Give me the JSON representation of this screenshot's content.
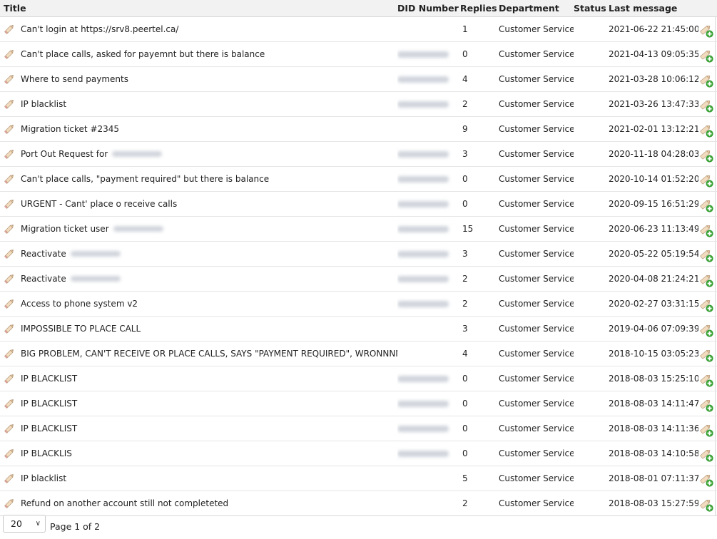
{
  "columns": {
    "title": "Title",
    "did": "DID Number",
    "replies": "Replies",
    "department": "Department",
    "status": "Status",
    "last_message": "Last message"
  },
  "icons": {
    "row_edit": "pencil-icon",
    "row_action": "add-note-icon",
    "accent": "#3aa635"
  },
  "tickets": [
    {
      "title": "Can't login at https://srv8.peertel.ca/",
      "did_blurred": false,
      "title_suffix_blurred": false,
      "replies": "1",
      "department": "Customer Service",
      "status": "",
      "last_message": "2021-06-22 21:45:00"
    },
    {
      "title": "Can't place calls, asked for payemnt but there is balance",
      "did_blurred": true,
      "title_suffix_blurred": false,
      "replies": "0",
      "department": "Customer Service",
      "status": "",
      "last_message": "2021-04-13 09:05:35"
    },
    {
      "title": "Where to send payments",
      "did_blurred": true,
      "title_suffix_blurred": false,
      "replies": "4",
      "department": "Customer Service",
      "status": "",
      "last_message": "2021-03-28 10:06:12"
    },
    {
      "title": "IP blacklist",
      "did_blurred": true,
      "title_suffix_blurred": false,
      "replies": "2",
      "department": "Customer Service",
      "status": "",
      "last_message": "2021-03-26 13:47:33"
    },
    {
      "title": "Migration ticket #2345",
      "did_blurred": false,
      "title_suffix_blurred": false,
      "replies": "9",
      "department": "Customer Service",
      "status": "",
      "last_message": "2021-02-01 13:12:21"
    },
    {
      "title": "Port Out Request for",
      "did_blurred": true,
      "title_suffix_blurred": true,
      "replies": "3",
      "department": "Customer Service",
      "status": "",
      "last_message": "2020-11-18 04:28:03"
    },
    {
      "title": "Can't place calls, \"payment required\" but there is balance",
      "did_blurred": true,
      "title_suffix_blurred": false,
      "replies": "0",
      "department": "Customer Service",
      "status": "",
      "last_message": "2020-10-14 01:52:20"
    },
    {
      "title": "URGENT - Cant' place o receive calls",
      "did_blurred": true,
      "title_suffix_blurred": false,
      "replies": "0",
      "department": "Customer Service",
      "status": "",
      "last_message": "2020-09-15 16:51:29"
    },
    {
      "title": "Migration ticket user",
      "did_blurred": true,
      "title_suffix_blurred": true,
      "replies": "15",
      "department": "Customer Service",
      "status": "",
      "last_message": "2020-06-23 11:13:49"
    },
    {
      "title": "Reactivate",
      "did_blurred": true,
      "title_suffix_blurred": true,
      "replies": "3",
      "department": "Customer Service",
      "status": "",
      "last_message": "2020-05-22 05:19:54"
    },
    {
      "title": "Reactivate",
      "did_blurred": true,
      "title_suffix_blurred": true,
      "replies": "2",
      "department": "Customer Service",
      "status": "",
      "last_message": "2020-04-08 21:24:21"
    },
    {
      "title": "Access to phone system v2",
      "did_blurred": true,
      "title_suffix_blurred": false,
      "replies": "2",
      "department": "Customer Service",
      "status": "",
      "last_message": "2020-02-27 03:31:15"
    },
    {
      "title": "IMPOSSIBLE TO PLACE CALL",
      "did_blurred": false,
      "title_suffix_blurred": false,
      "replies": "3",
      "department": "Customer Service",
      "status": "",
      "last_message": "2019-04-06 07:09:39"
    },
    {
      "title": "BIG PROBLEM, CAN'T RECEIVE OR PLACE CALLS, SAYS \"PAYMENT REQUIRED\", WRONNNNNG",
      "did_blurred": false,
      "title_suffix_blurred": false,
      "replies": "4",
      "department": "Customer Service",
      "status": "",
      "last_message": "2018-10-15 03:05:23"
    },
    {
      "title": "IP BLACKLIST",
      "did_blurred": true,
      "title_suffix_blurred": false,
      "replies": "0",
      "department": "Customer Service",
      "status": "",
      "last_message": "2018-08-03 15:25:10"
    },
    {
      "title": "IP BLACKLIST",
      "did_blurred": true,
      "title_suffix_blurred": false,
      "replies": "0",
      "department": "Customer Service",
      "status": "",
      "last_message": "2018-08-03 14:11:47"
    },
    {
      "title": "IP BLACKLIST",
      "did_blurred": true,
      "title_suffix_blurred": false,
      "replies": "0",
      "department": "Customer Service",
      "status": "",
      "last_message": "2018-08-03 14:11:36"
    },
    {
      "title": "IP BLACKLIS",
      "did_blurred": true,
      "title_suffix_blurred": false,
      "replies": "0",
      "department": "Customer Service",
      "status": "",
      "last_message": "2018-08-03 14:10:58"
    },
    {
      "title": "IP blacklist",
      "did_blurred": false,
      "title_suffix_blurred": false,
      "replies": "5",
      "department": "Customer Service",
      "status": "",
      "last_message": "2018-08-01 07:11:37"
    },
    {
      "title": "Refund on another account still not completeted",
      "did_blurred": false,
      "title_suffix_blurred": false,
      "replies": "2",
      "department": "Customer Service",
      "status": "",
      "last_message": "2018-08-03 15:27:59"
    }
  ],
  "pagination": {
    "page_size": "20",
    "page_info": "Page 1 of 2"
  }
}
